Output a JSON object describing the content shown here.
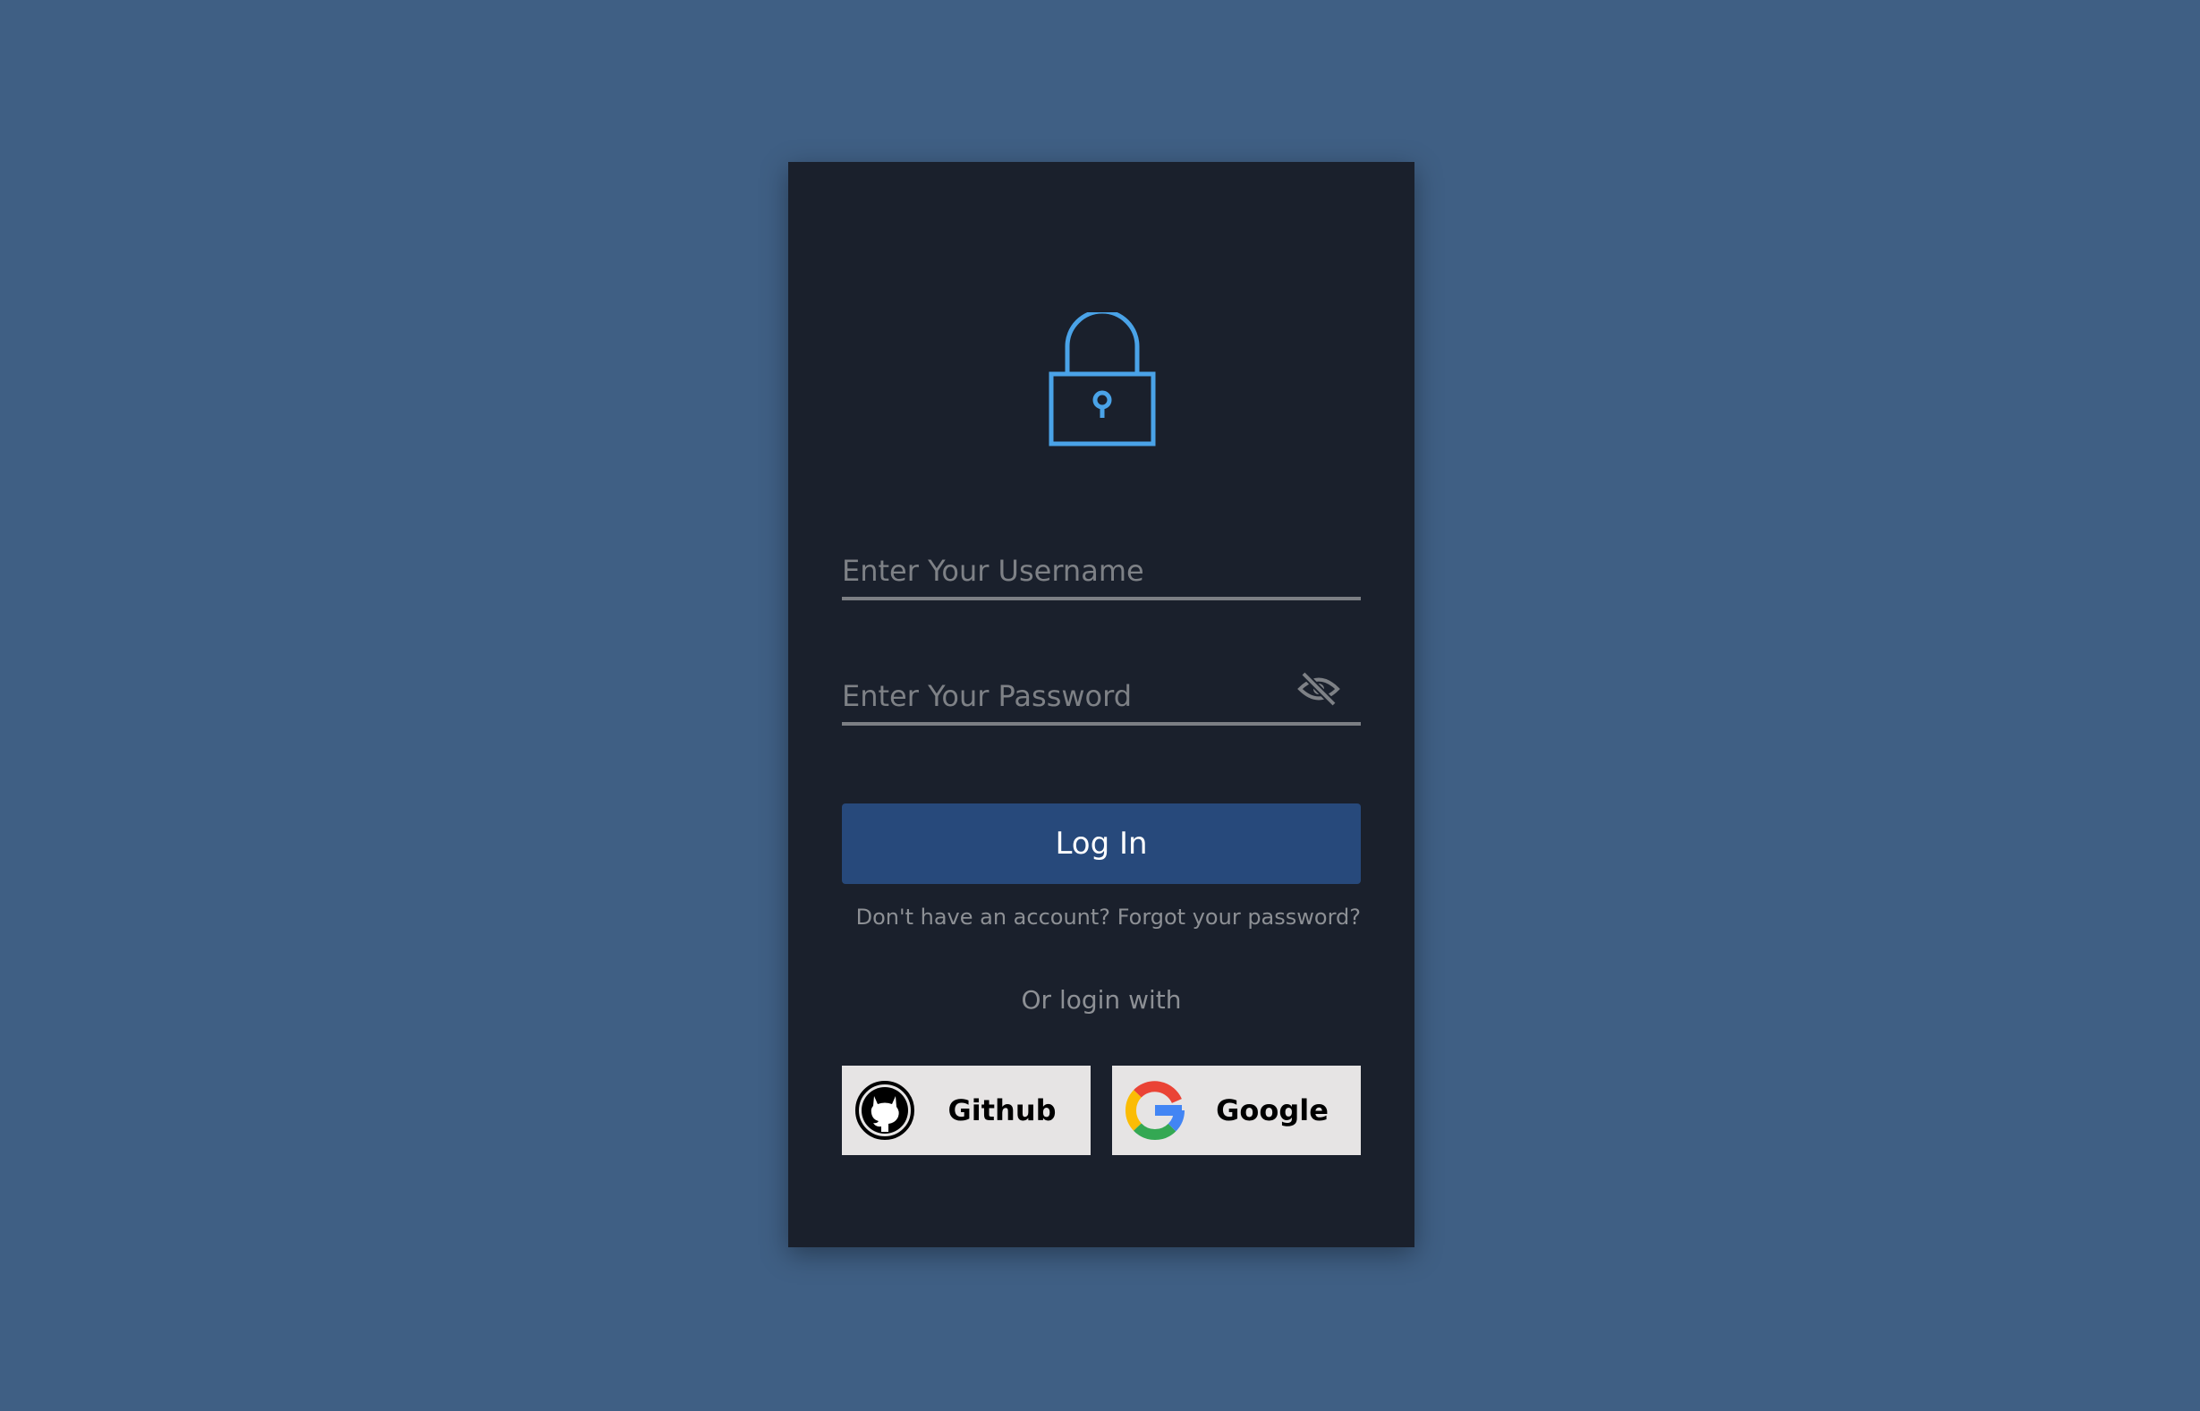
{
  "colors": {
    "background": "#3f5f84",
    "card": "#1a202c",
    "accent": "#4aa3e8",
    "primary_button": "#27497b",
    "social_button": "#e6e4e4"
  },
  "header": {
    "icon": "lock-icon"
  },
  "form": {
    "username_placeholder": "Enter Your Username",
    "username_value": "",
    "password_placeholder": "Enter Your Password",
    "password_value": "",
    "password_toggle_icon": "eye-slash-icon",
    "login_label": "Log In"
  },
  "links": {
    "signup": "Don't have an account?",
    "forgot": "Forgot your password?"
  },
  "social": {
    "divider_text": "Or login with",
    "github": {
      "label": "Github",
      "icon": "github-icon"
    },
    "google": {
      "label": "Google",
      "icon": "google-icon"
    }
  }
}
